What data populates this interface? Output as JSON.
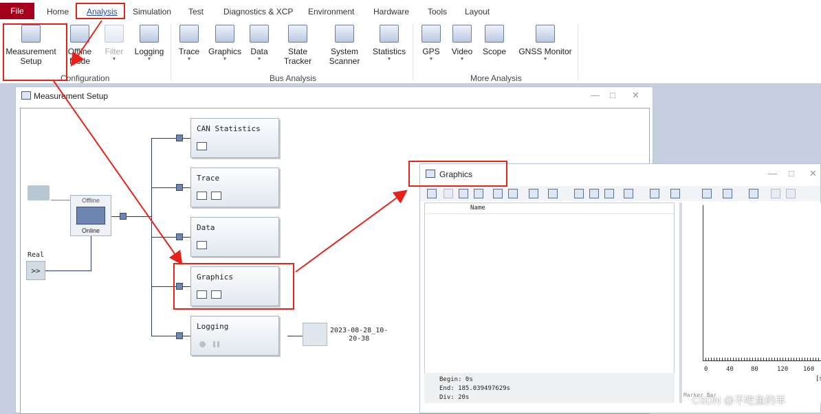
{
  "tabs": {
    "file": "File",
    "items": [
      "Home",
      "Analysis",
      "Simulation",
      "Test",
      "Diagnostics & XCP",
      "Environment",
      "Hardware",
      "Tools",
      "Layout"
    ]
  },
  "ribbon": {
    "measurement_setup_1": "Measurement",
    "measurement_setup_2": "Setup",
    "offline_mode_1": "Offline",
    "offline_mode_2": "Mode",
    "filter": "Filter",
    "logging": "Logging",
    "trace": "Trace",
    "graphics": "Graphics",
    "data": "Data",
    "state_tracker_1": "State",
    "state_tracker_2": "Tracker",
    "system_scanner_1": "System",
    "system_scanner_2": "Scanner",
    "statistics": "Statistics",
    "gps": "GPS",
    "video": "Video",
    "scope": "Scope",
    "gnss": "GNSS Monitor",
    "group_configuration": "Configuration",
    "group_bus_analysis": "Bus Analysis",
    "group_more_analysis": "More Analysis"
  },
  "measurement_setup": {
    "title": "Measurement Setup",
    "switch_offline": "Offline",
    "switch_online": "Online",
    "real_label": "Real",
    "real_glyph": ">>",
    "nodes": [
      "CAN Statistics",
      "Trace",
      "Data",
      "Graphics",
      "Logging"
    ],
    "log_file_1": "2023-08-28_10-",
    "log_file_2": "20-38"
  },
  "graphics_window": {
    "title": "Graphics",
    "column_name": "Name",
    "begin": "Begin: 0s",
    "end": "End: 185.039497629s",
    "div": "Div: 20s",
    "marker_bar": "Marker Bar",
    "axis_ticks": [
      "0",
      "40",
      "80",
      "120",
      "160"
    ],
    "axis_unit": "[s"
  },
  "watermark": "CSDN @不吃鱼的羊",
  "colors": {
    "accent_red": "#e62117",
    "file_tab": "#a4001d",
    "analysis_tab": "#1f4db5"
  }
}
